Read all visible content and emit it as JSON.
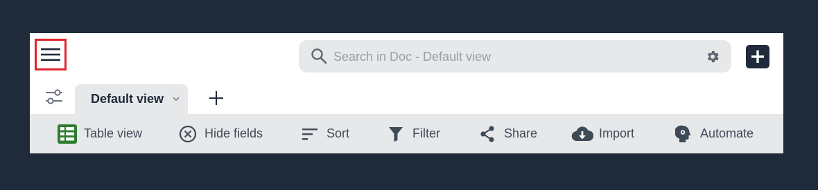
{
  "search": {
    "placeholder": "Search in Doc - Default view"
  },
  "tabs": [
    {
      "label": "Default view"
    }
  ],
  "toolbar": {
    "items": [
      {
        "label": "Table view",
        "icon": "table-grid-icon"
      },
      {
        "label": "Hide fields",
        "icon": "circle-x-icon"
      },
      {
        "label": "Sort",
        "icon": "sort-lines-icon"
      },
      {
        "label": "Filter",
        "icon": "funnel-icon"
      },
      {
        "label": "Share",
        "icon": "share-icon"
      },
      {
        "label": "Import",
        "icon": "cloud-download-icon"
      },
      {
        "label": "Automate",
        "icon": "automate-head-icon"
      }
    ]
  },
  "colors": {
    "background": "#1f2b3a",
    "highlight": "#e0232b",
    "table_icon": "#2e7d32",
    "toolbar_bg": "#e7e8ea"
  }
}
